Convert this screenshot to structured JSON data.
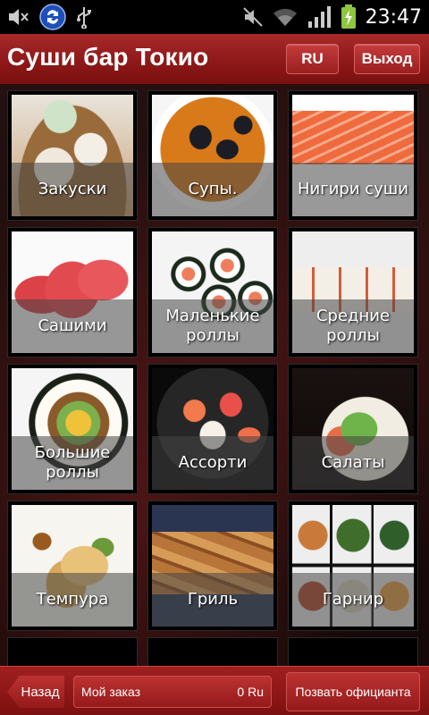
{
  "status_bar": {
    "time": "23:47",
    "icons_left": [
      "mute-icon",
      "sync-icon",
      "usb-icon"
    ],
    "icons_right": [
      "silent-mode-icon",
      "wifi-icon",
      "signal-icon",
      "battery-charging-icon"
    ]
  },
  "header": {
    "title": "Суши бар Токио",
    "lang_label": "RU",
    "exit_label": "Выход"
  },
  "colors": {
    "header_red": "#8c1717",
    "button_red": "#bc3232",
    "tile_label_bg": "#464646"
  },
  "menu": {
    "items": [
      {
        "label": "Закуски",
        "photo": "dumplings-photo"
      },
      {
        "label": "Супы.",
        "photo": "mussel-soup-photo"
      },
      {
        "label": "Нигири суши",
        "photo": "salmon-nigiri-photo"
      },
      {
        "label": "Сашими",
        "photo": "tuna-sashimi-photo"
      },
      {
        "label": "Маленькие роллы",
        "photo": "small-rolls-photo"
      },
      {
        "label": "Средние роллы",
        "photo": "medium-rolls-photo"
      },
      {
        "label": "Большие роллы",
        "photo": "big-roll-photo"
      },
      {
        "label": "Ассорти",
        "photo": "assorted-sushi-photo"
      },
      {
        "label": "Салаты",
        "photo": "salad-photo"
      },
      {
        "label": "Темпура",
        "photo": "tempura-photo"
      },
      {
        "label": "Гриль",
        "photo": "grill-skewers-photo"
      },
      {
        "label": "Гарнир",
        "photo": "side-dishes-photo"
      }
    ]
  },
  "bottom": {
    "back_label": "Назад",
    "order_label": "Мой заказ",
    "order_total": "0 Ru",
    "waiter_label": "Позвать официанта"
  }
}
